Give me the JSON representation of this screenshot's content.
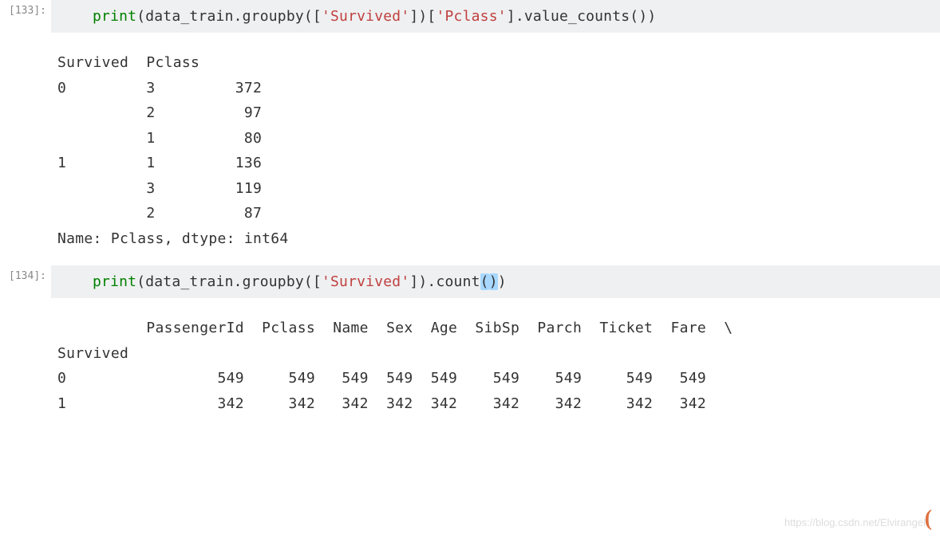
{
  "cell1": {
    "prompt": "[133]:",
    "code": {
      "kw": "print",
      "open_paren": "(",
      "obj": "data_train.groupby([",
      "str1": "'Survived'",
      "mid": "])[",
      "str2": "'Pclass'",
      "tail": "].value_counts())"
    },
    "output": "Survived  Pclass\n0         3         372\n          2          97\n          1          80\n1         1         136\n          3         119\n          2          87\nName: Pclass, dtype: int64"
  },
  "cell2": {
    "prompt": "[134]:",
    "code": {
      "kw": "print",
      "open_paren": "(",
      "obj": "data_train.groupby([",
      "str1": "'Survived'",
      "mid": "]).count",
      "hl_open": "(",
      "hl_close": ")",
      "tail": ")"
    },
    "output": "          PassengerId  Pclass  Name  Sex  Age  SibSp  Parch  Ticket  Fare  \\\nSurvived                                                                    \n0                 549     549   549  549  549    549    549     549   549   \n1                 342     342   342  342  342    342    342     342   342   "
  },
  "watermark": "https://blog.csdn.net/Elvirangel",
  "paren_glyph": "("
}
